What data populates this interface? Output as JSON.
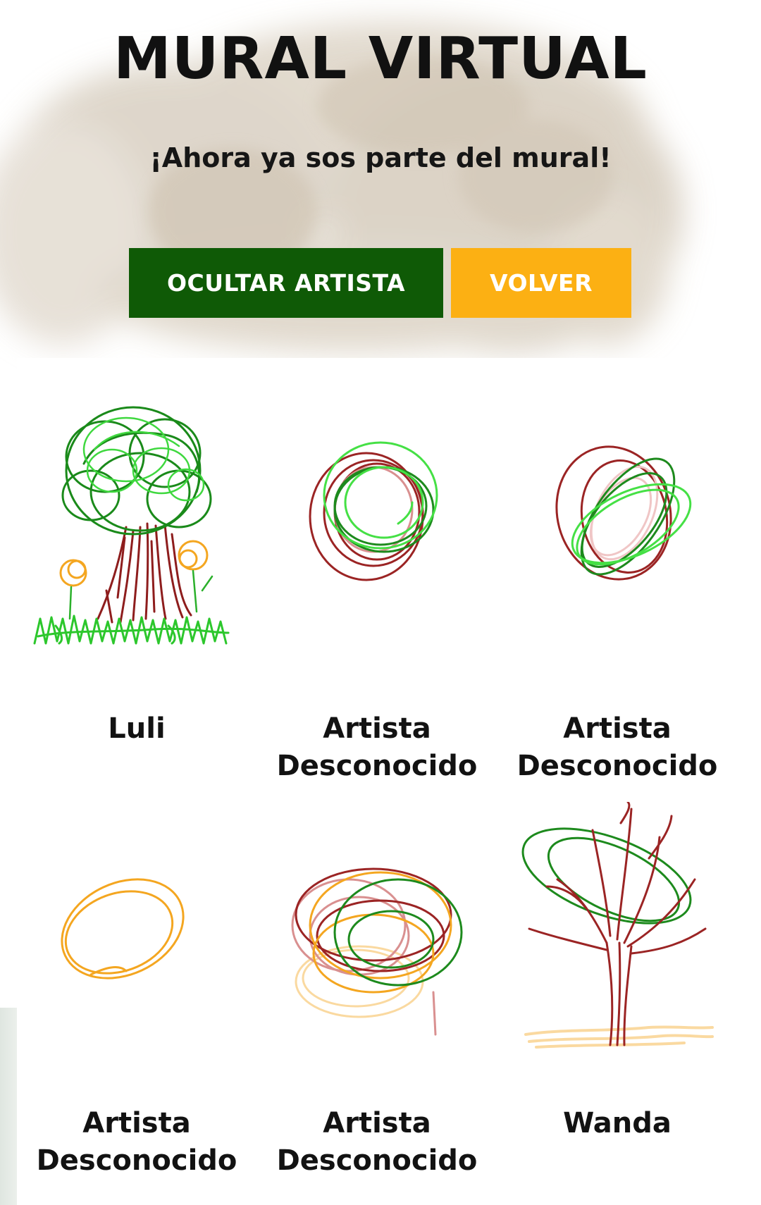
{
  "header": {
    "title": "MURAL VIRTUAL",
    "subtitle": "¡Ahora ya sos parte del mural!"
  },
  "buttons": {
    "hide_artist_label": "OCULTAR ARTISTA",
    "back_label": "VOLVER"
  },
  "colors": {
    "primary_green": "#0f5a06",
    "accent_orange": "#fcb013",
    "wash_beige": "#d8cfc2"
  },
  "mural": {
    "drawings": [
      {
        "artist": "Luli",
        "depicts": "tree-with-flowers-drawing"
      },
      {
        "artist": "Artista Desconocido",
        "depicts": "circle-scribble-drawing"
      },
      {
        "artist": "Artista Desconocido",
        "depicts": "oval-scribble-drawing"
      },
      {
        "artist": "Artista Desconocido",
        "depicts": "orange-loop-drawing"
      },
      {
        "artist": "Artista Desconocido",
        "depicts": "multicolor-scribble-drawing"
      },
      {
        "artist": "Wanda",
        "depicts": "bare-tree-drawing"
      }
    ]
  }
}
